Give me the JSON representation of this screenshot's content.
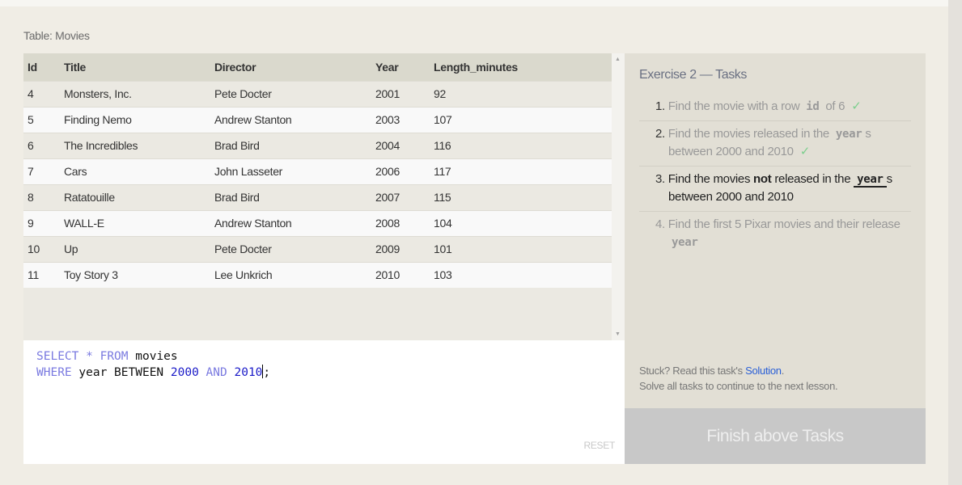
{
  "table_label": "Table: Movies",
  "columns": [
    "Id",
    "Title",
    "Director",
    "Year",
    "Length_minutes"
  ],
  "rows": [
    [
      "4",
      "Monsters, Inc.",
      "Pete Docter",
      "2001",
      "92"
    ],
    [
      "5",
      "Finding Nemo",
      "Andrew Stanton",
      "2003",
      "107"
    ],
    [
      "6",
      "The Incredibles",
      "Brad Bird",
      "2004",
      "116"
    ],
    [
      "7",
      "Cars",
      "John Lasseter",
      "2006",
      "117"
    ],
    [
      "8",
      "Ratatouille",
      "Brad Bird",
      "2007",
      "115"
    ],
    [
      "9",
      "WALL-E",
      "Andrew Stanton",
      "2008",
      "104"
    ],
    [
      "10",
      "Up",
      "Pete Docter",
      "2009",
      "101"
    ],
    [
      "11",
      "Toy Story 3",
      "Lee Unkrich",
      "2010",
      "103"
    ]
  ],
  "editor": {
    "l1": [
      "SELECT",
      "*",
      "FROM",
      "movies"
    ],
    "l2": [
      "WHERE",
      "year",
      "BETWEEN",
      "2000",
      "AND",
      "2010",
      ";"
    ],
    "reset": "RESET"
  },
  "tasks": {
    "title": "Exercise 2 — Tasks",
    "items": [
      {
        "n": "1.",
        "a": "Find the movie with a row ",
        "code": "id",
        "b": " of 6",
        "check": "✓"
      },
      {
        "n": "2.",
        "a": "Find the movies released in the ",
        "code": "year",
        "b": "s between 2000 and 2010",
        "check": "✓"
      },
      {
        "n": "3.",
        "a": "Find the movies ",
        "bold": "not",
        "a2": " released in the ",
        "code": "year",
        "b": "s between 2000 and 2010"
      },
      {
        "n": "4.",
        "a": "Find the first 5 Pixar movies and their release ",
        "code": "year"
      }
    ],
    "stuck_pre": "Stuck? Read this task's ",
    "solution": "Solution",
    "stuck_post": ".",
    "solve_all": "Solve all tasks to continue to the next lesson."
  },
  "finish": "Finish above Tasks"
}
